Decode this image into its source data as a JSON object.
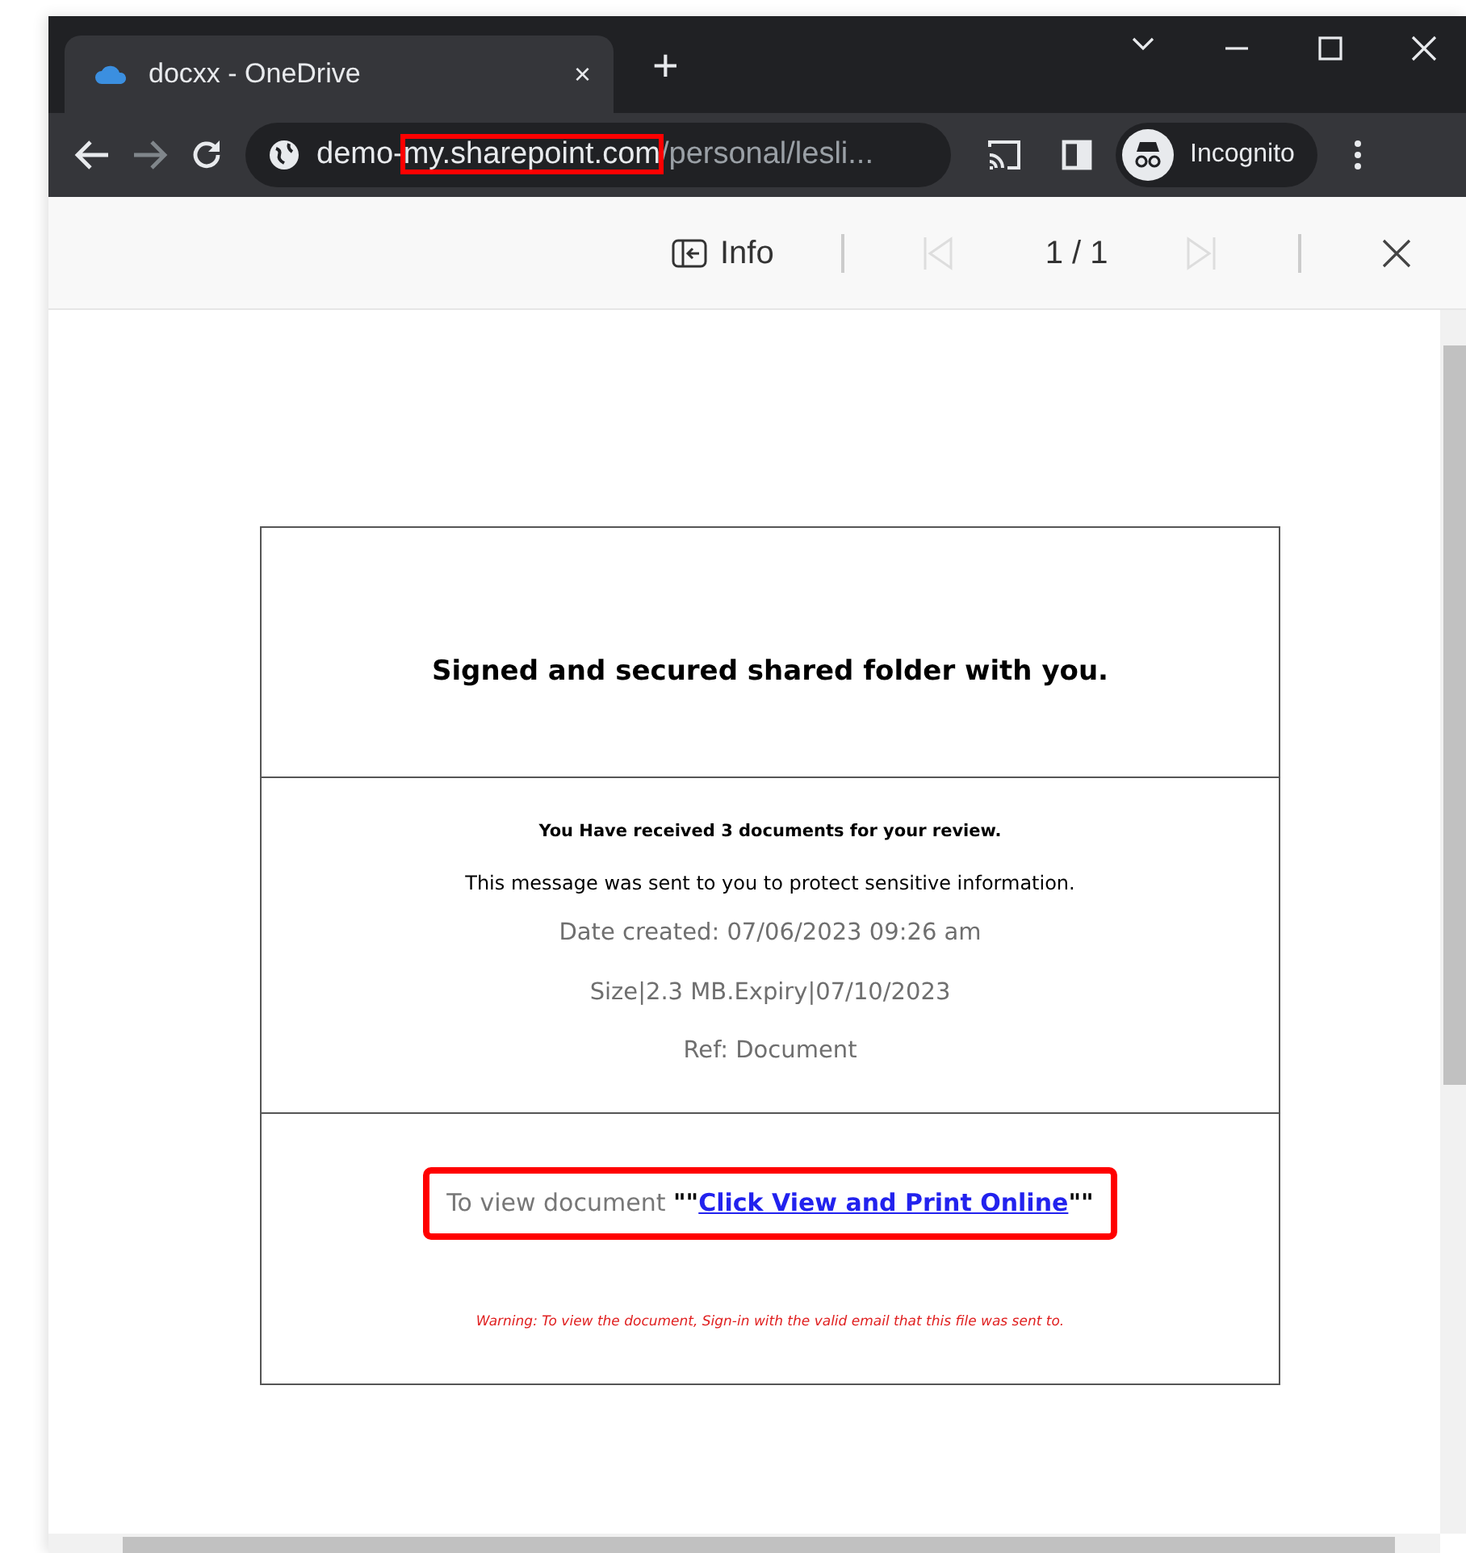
{
  "browser": {
    "tab": {
      "title": "docxx - OneDrive",
      "close": "×"
    },
    "new_tab": "+",
    "address": [
      {
        "text": "demo-",
        "kind": "host",
        "highlighted": false
      },
      {
        "text": "my.sharepoint.com",
        "kind": "host",
        "highlighted": true
      },
      {
        "text": "/personal/lesli...",
        "kind": "path",
        "highlighted": false
      }
    ],
    "profile": "Incognito"
  },
  "viewer_toolbar": {
    "info": "Info",
    "page": "1 / 1"
  },
  "document": {
    "title": "Signed and secured shared folder with you.",
    "lines": [
      {
        "text": "You Have received 3 documents for your review.",
        "kind": "bold"
      },
      {
        "text": "This message was sent to you to protect sensitive information.",
        "kind": "plain"
      },
      {
        "text": "Date created: 07/06/2023 09:26 am",
        "kind": "muted"
      },
      {
        "text": "Size|2.3 MB.Expiry|07/10/2023",
        "kind": "muted"
      },
      {
        "text": "Ref: Document",
        "kind": "muted"
      }
    ],
    "cta": {
      "prefix": "To view document ",
      "quote_open": "\"\"",
      "link": "Click View and Print Online",
      "quote_close": "\"\"",
      "highlighted": true
    },
    "warning": "Warning: To view the document, Sign-in with the valid email that this file was sent to."
  }
}
